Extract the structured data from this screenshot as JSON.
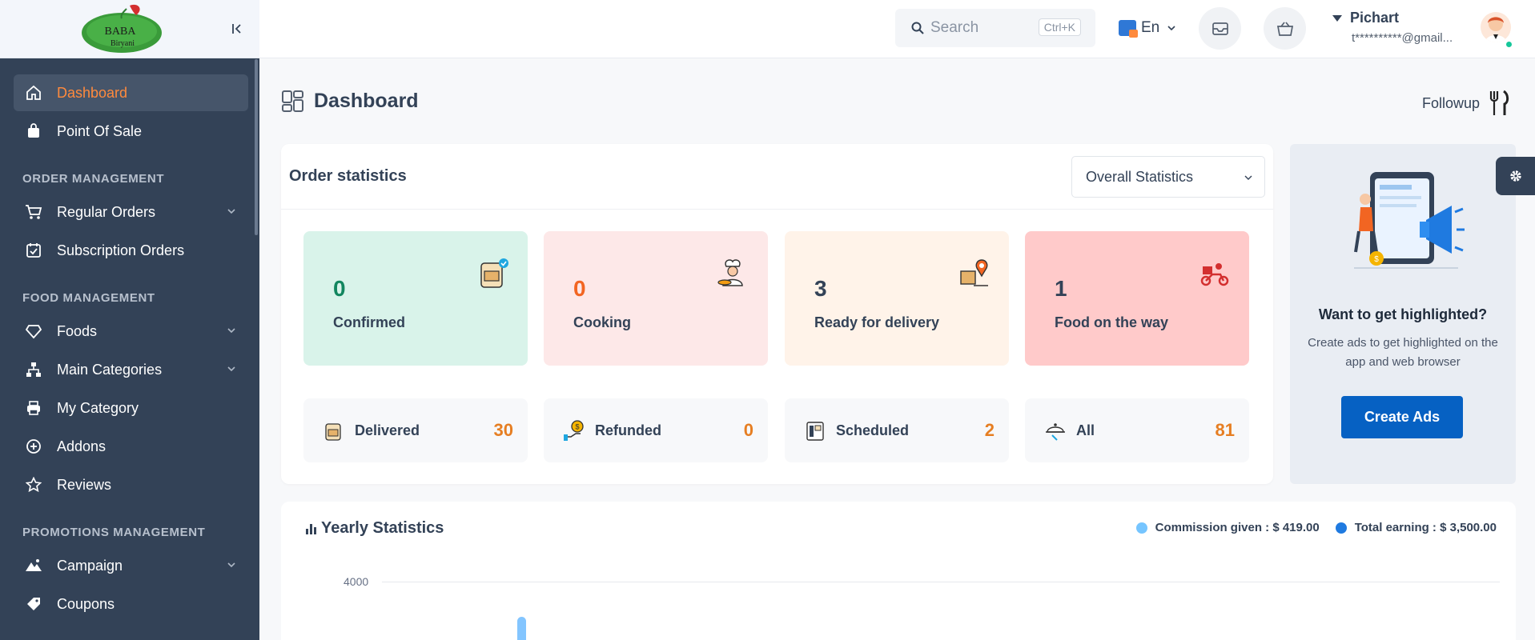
{
  "brand": {
    "logo_text_1": "BABA",
    "logo_text_2": "Biryani"
  },
  "sidebar": {
    "items": [
      {
        "label": "Dashboard"
      },
      {
        "label": "Point Of Sale"
      }
    ],
    "sections": [
      {
        "title": "ORDER MANAGEMENT",
        "items": [
          {
            "label": "Regular Orders"
          },
          {
            "label": "Subscription Orders"
          }
        ]
      },
      {
        "title": "FOOD MANAGEMENT",
        "items": [
          {
            "label": "Foods"
          },
          {
            "label": "Main Categories"
          },
          {
            "label": "My Category"
          },
          {
            "label": "Addons"
          },
          {
            "label": "Reviews"
          }
        ]
      },
      {
        "title": "PROMOTIONS MANAGEMENT",
        "items": [
          {
            "label": "Campaign"
          },
          {
            "label": "Coupons"
          }
        ]
      }
    ]
  },
  "header": {
    "search_placeholder": "Search",
    "search_shortcut": "Ctrl+K",
    "language": "En",
    "user_name": "Pichart",
    "user_email": "t**********@gmail..."
  },
  "page": {
    "title": "Dashboard",
    "followup": "Followup"
  },
  "order_stats": {
    "title": "Order statistics",
    "filter": "Overall Statistics",
    "tiles": [
      {
        "value": "0",
        "label": "Confirmed",
        "bg": "#d9f3ea",
        "color": "#12865f"
      },
      {
        "value": "0",
        "label": "Cooking",
        "bg": "#fde8e8",
        "color": "#f26522"
      },
      {
        "value": "3",
        "label": "Ready for delivery",
        "bg": "#fff3e9",
        "color": "#334257"
      },
      {
        "value": "1",
        "label": "Food on the way",
        "bg": "#ffcaca",
        "color": "#334257"
      }
    ],
    "mini": [
      {
        "label": "Delivered",
        "value": "30"
      },
      {
        "label": "Refunded",
        "value": "0"
      },
      {
        "label": "Scheduled",
        "value": "2"
      },
      {
        "label": "All",
        "value": "81"
      }
    ]
  },
  "promo": {
    "title": "Want to get highlighted?",
    "desc": "Create ads to get highlighted on the app and web browser",
    "button": "Create Ads"
  },
  "yearly": {
    "title": "Yearly Statistics",
    "commission_label": "Commission given : $ 419.00",
    "earning_label": "Total earning : $ 3,500.00",
    "commission_color": "#76c5ff",
    "earning_color": "#1f7ae0"
  },
  "chart_data": {
    "type": "bar",
    "title": "Yearly Statistics",
    "y_ticks_visible": [
      4000
    ],
    "series": [
      {
        "name": "Commission given",
        "total": 419.0
      },
      {
        "name": "Total earning",
        "total": 3500.0
      }
    ]
  }
}
